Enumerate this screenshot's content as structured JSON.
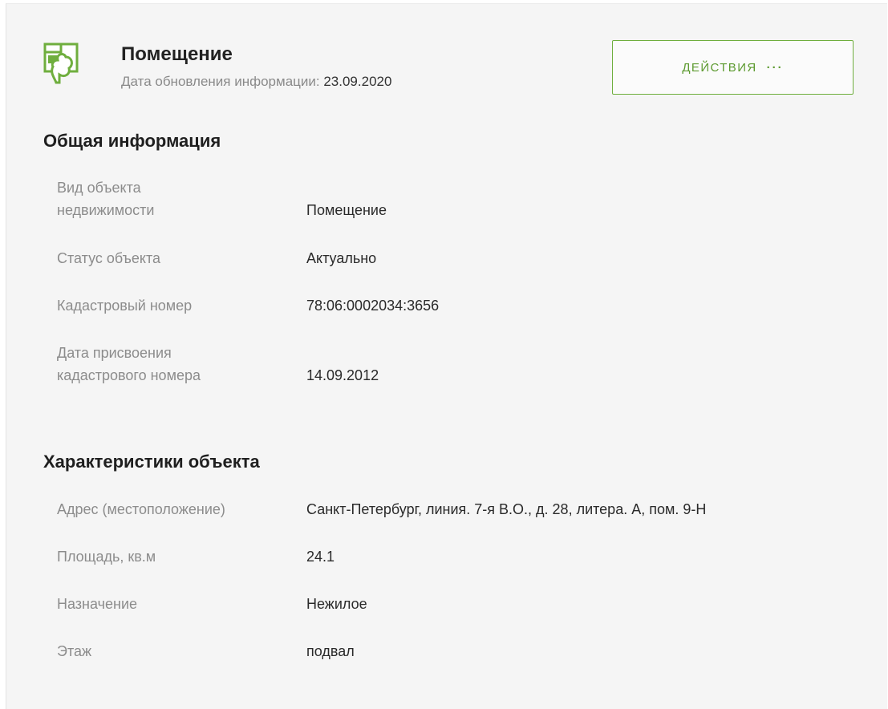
{
  "header": {
    "title": "Помещение",
    "updated_label": "Дата обновления информации:",
    "updated_date": "23.09.2020",
    "actions_label": "ДЕЙСТВИЯ",
    "actions_dots": "···",
    "icon": "building-tree-icon",
    "accent_color": "#6fae3e"
  },
  "general": {
    "title": "Общая информация",
    "rows": [
      {
        "label": "Вид объекта недвижимости",
        "value": "Помещение"
      },
      {
        "label": "Статус объекта",
        "value": "Актуально"
      },
      {
        "label": "Кадастровый номер",
        "value": "78:06:0002034:3656"
      },
      {
        "label": "Дата присвоения кадастрового номера",
        "value": "14.09.2012"
      }
    ]
  },
  "characteristics": {
    "title": "Характеристики объекта",
    "rows": [
      {
        "label": "Адрес (местоположение)",
        "value": "Санкт-Петербург, линия. 7-я В.О., д. 28, литера. А, пом. 9-Н"
      },
      {
        "label": "Площадь, кв.м",
        "value": "24.1"
      },
      {
        "label": "Назначение",
        "value": "Нежилое"
      },
      {
        "label": "Этаж",
        "value": "подвал"
      }
    ]
  }
}
